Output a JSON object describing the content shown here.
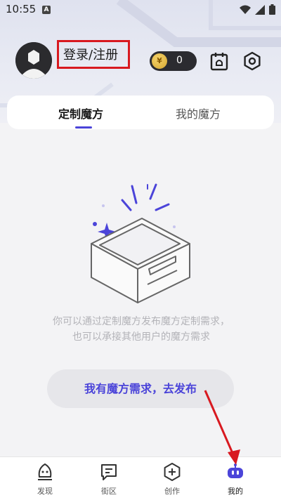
{
  "status_bar": {
    "time": "10:55",
    "notification_letter": "A"
  },
  "header": {
    "login_label": "登录/注册",
    "coin_symbol": "¥",
    "coin_count": "0"
  },
  "tabs": [
    {
      "label": "定制魔方",
      "active": true
    },
    {
      "label": "我的魔方",
      "active": false
    }
  ],
  "empty_state": {
    "description": "你可以通过定制魔方发布魔方定制需求，也可以承接其他用户的魔方需求",
    "button_label": "我有魔方需求，去发布"
  },
  "bottom_nav": [
    {
      "label": "发现",
      "icon": "rocket-icon",
      "active": false
    },
    {
      "label": "街区",
      "icon": "chat-icon",
      "active": false
    },
    {
      "label": "创作",
      "icon": "plus-hexagon-icon",
      "active": false
    },
    {
      "label": "我的",
      "icon": "profile-bot-icon",
      "active": true
    }
  ],
  "colors": {
    "accent": "#4b44d9",
    "annotation_red": "#d81920",
    "header_bg": "#e3e5f0"
  }
}
